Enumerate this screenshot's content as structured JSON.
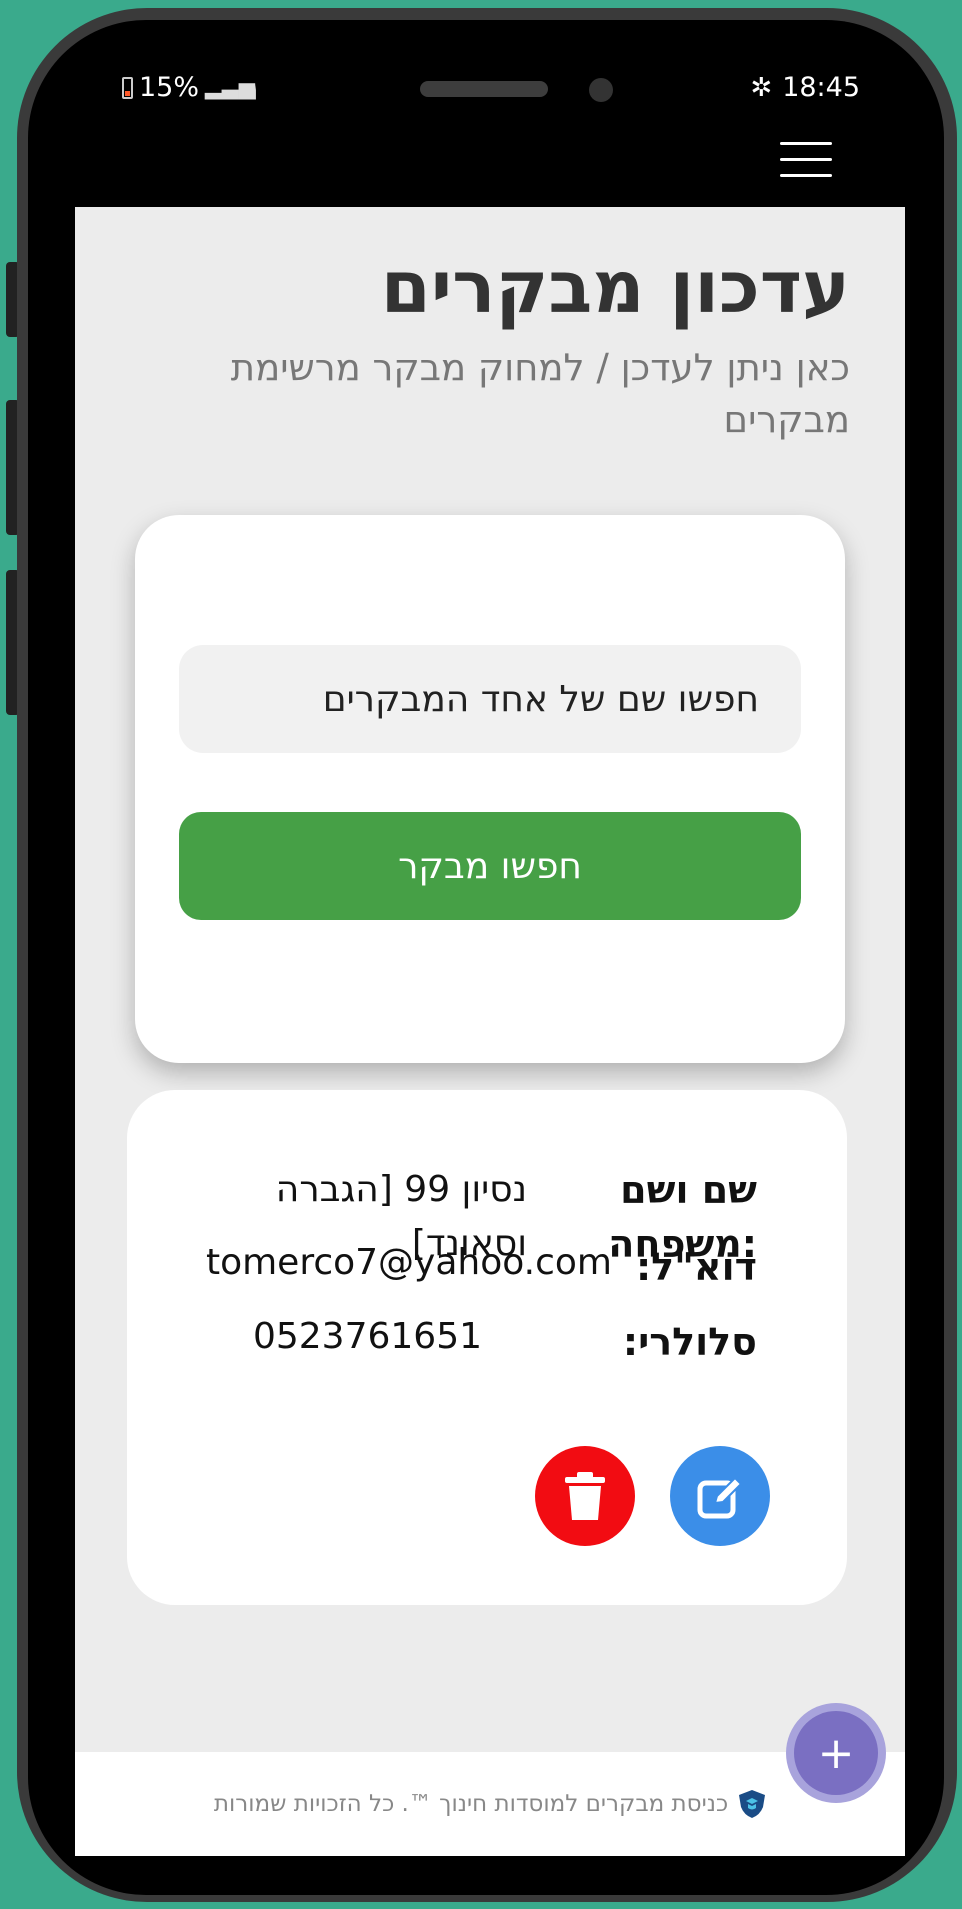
{
  "status_bar": {
    "battery": "15%",
    "time": "18:45"
  },
  "header": {
    "title": "עדכון מבקרים",
    "subtitle": "כאן ניתן לעדכן / למחוק מבקר מרשימת מבקרים"
  },
  "search": {
    "placeholder": "חפשו שם של אחד המבקרים",
    "button_label": "חפשו מבקר"
  },
  "result": {
    "name_label": "שם ושם משפחה:",
    "name_value": "נסיון 99 [הגברה וסאונד]",
    "email_label": "דוא\"ל:",
    "email_value": "tomerco7@yahoo.com",
    "phone_label": "סלולרי:",
    "phone_value": "0523761651"
  },
  "footer": {
    "text": "כניסת מבקרים למוסדות חינוך ™. כל הזכויות שמורות"
  },
  "fab": {
    "label": "+"
  },
  "colors": {
    "primary_green": "#46a046",
    "edit_blue": "#3b8ee8",
    "delete_red": "#f20c12",
    "fab_purple": "#7a6fc2"
  },
  "icons": {
    "edit": "edit-icon",
    "delete": "trash-icon",
    "menu": "hamburger-icon",
    "logo": "shield-icon"
  }
}
